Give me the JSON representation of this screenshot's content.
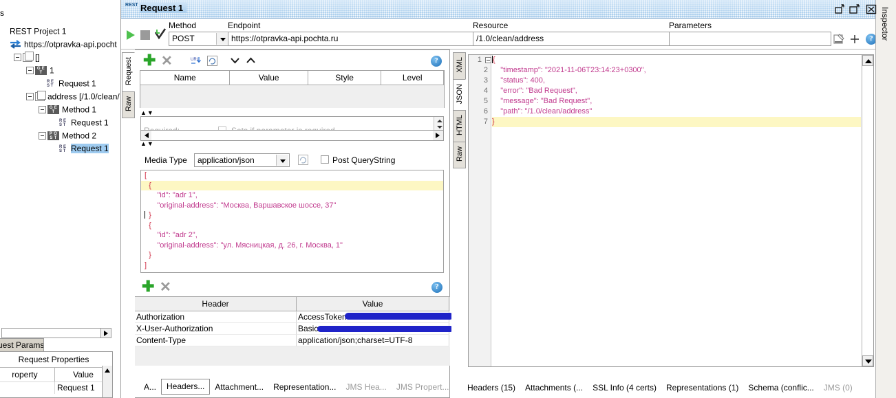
{
  "window": {
    "title": "Request 1",
    "title_icon": "rest-icon",
    "buttons": [
      {
        "name": "restore-button",
        "glyph": "restore"
      },
      {
        "name": "maximize-button",
        "glyph": "maximize"
      },
      {
        "name": "close-button",
        "glyph": "close"
      }
    ]
  },
  "navigator": {
    "header": "s",
    "hscroll": {
      "name": "navigator-hscrollbar"
    },
    "tree": [
      {
        "label": "REST Project 1",
        "icon": "project-icon",
        "indent": 0,
        "expander": false,
        "selected": false
      },
      {
        "label": "https://otpravka-api.pocht",
        "icon": "service-arrows-icon",
        "indent": 0,
        "expander": false,
        "selected": false
      },
      {
        "label": "[]",
        "icon": "resource-icon",
        "indent": 1,
        "expander": true,
        "selected": false
      },
      {
        "label": "1",
        "icon": "get-badge",
        "indent": 2,
        "expander": true,
        "selected": false
      },
      {
        "label": "Request 1",
        "icon": "rest-icon",
        "indent": 3,
        "expander": false,
        "selected": false
      },
      {
        "label": "address [/1.0/clean/",
        "icon": "resource-icon",
        "indent": 2,
        "expander": true,
        "selected": false
      },
      {
        "label": "Method 1",
        "icon": "get-badge",
        "indent": 3,
        "expander": true,
        "selected": false
      },
      {
        "label": "Request 1",
        "icon": "rest-icon",
        "indent": 4,
        "expander": false,
        "selected": false
      },
      {
        "label": "Method 2",
        "icon": "post-badge",
        "indent": 3,
        "expander": true,
        "selected": false
      },
      {
        "label": "Request 1",
        "icon": "rest-icon",
        "indent": 4,
        "expander": false,
        "selected": true
      }
    ],
    "request_params_tab": "uest Params",
    "properties": {
      "title": "Request Properties",
      "columns": [
        "roperty",
        "Value"
      ],
      "rows": [
        [
          "",
          "Request 1"
        ]
      ]
    }
  },
  "toolbar": {
    "run_button": "run-icon",
    "stop_button": "stop-icon",
    "validate_button": "check-icon",
    "method": {
      "label": "Method",
      "value": "POST"
    },
    "endpoint": {
      "label": "Endpoint",
      "value": "https://otpravka-api.pochta.ru"
    },
    "resource": {
      "label": "Resource",
      "value": "/1.0/clean/address"
    },
    "parameters": {
      "label": "Parameters",
      "value": ""
    },
    "param_editor_icon": "param-editor-icon",
    "add_param_icon": "plus-icon",
    "help_icon": "?"
  },
  "request_panel": {
    "vtabs": [
      {
        "label": "Request",
        "active": true
      },
      {
        "label": "Raw",
        "active": false
      }
    ],
    "param_toolbar": {
      "add": "plus-icon",
      "remove": "x-icon",
      "url_icon": "url-encode-icon",
      "refresh_icon": "refresh-icon",
      "down_icon": "move-down-icon",
      "up_icon": "move-up-icon",
      "help": "?"
    },
    "param_table": {
      "columns": [
        "Name",
        "Value",
        "Style",
        "Level"
      ],
      "rows": []
    },
    "param_detail": {
      "required_label": "Required:",
      "required_desc": "Sets if parameter is required",
      "checked": false
    },
    "media_type": {
      "label": "Media Type",
      "value": "application/json",
      "format_icon": "format-json-icon",
      "post_querystring": {
        "label": "Post QueryString",
        "checked": false
      }
    },
    "body_editor": {
      "lines": [
        {
          "text": "[",
          "cls": "jbrace",
          "hl": false
        },
        {
          "text": "  {",
          "cls": "jbrace",
          "hl": true
        },
        {
          "text": "      \"id\": \"adr 1\",",
          "cls": "jkey",
          "hl": false
        },
        {
          "text": "      \"original-address\": \"Москва, Варшавское шоссе, 37\"",
          "cls": "jkey",
          "hl": false
        },
        {
          "text": "  }",
          "cls": "jbrace",
          "hl": false
        },
        {
          "text": "  {",
          "cls": "jbrace",
          "hl": false
        },
        {
          "text": "      \"id\": \"adr 2\",",
          "cls": "jkey",
          "hl": false
        },
        {
          "text": "      \"original-address\": \"ул. Мясницкая, д. 26, г. Москва, 1\"",
          "cls": "jkey",
          "hl": false
        },
        {
          "text": "  }",
          "cls": "jbrace",
          "hl": false
        },
        {
          "text": "]",
          "cls": "jbrace",
          "hl": false
        }
      ]
    },
    "headers_toolbar": {
      "add": "plus-icon",
      "remove": "x-icon",
      "help": "?"
    },
    "headers_table": {
      "columns": [
        "Header",
        "Value"
      ],
      "rows": [
        {
          "header": "Authorization",
          "value": "AccessToken ",
          "redacted": true,
          "ellipsis": "..."
        },
        {
          "header": "X-User-Authorization",
          "value": "Basic ",
          "redacted": true,
          "ellipsis": "..."
        },
        {
          "header": "Content-Type",
          "value": "application/json;charset=UTF-8",
          "redacted": false,
          "ellipsis": ""
        }
      ]
    },
    "bottom_tabs": [
      {
        "label": "A...",
        "active": false,
        "dim": false
      },
      {
        "label": "Headers...",
        "active": true,
        "dim": false
      },
      {
        "label": "Attachment...",
        "active": false,
        "dim": false
      },
      {
        "label": "Representation...",
        "active": false,
        "dim": false
      },
      {
        "label": "JMS Hea...",
        "active": false,
        "dim": true
      },
      {
        "label": "JMS Propert...",
        "active": false,
        "dim": true
      }
    ]
  },
  "response_panel": {
    "vtabs": [
      {
        "label": "XML",
        "active": false
      },
      {
        "label": "JSON",
        "active": true
      },
      {
        "label": "HTML",
        "active": false
      },
      {
        "label": "Raw",
        "active": false
      }
    ],
    "editor": {
      "lines": [
        {
          "n": "1",
          "text": "{",
          "hl": false,
          "fold": true
        },
        {
          "n": "2",
          "text": "    \"timestamp\": \"2021-11-06T23:14:23+0300\",",
          "hl": false,
          "fold": false
        },
        {
          "n": "3",
          "text": "    \"status\": 400,",
          "hl": false,
          "fold": false
        },
        {
          "n": "4",
          "text": "    \"error\": \"Bad Request\",",
          "hl": false,
          "fold": false
        },
        {
          "n": "5",
          "text": "    \"message\": \"Bad Request\",",
          "hl": false,
          "fold": false
        },
        {
          "n": "6",
          "text": "    \"path\": \"/1.0/clean/address\"",
          "hl": false,
          "fold": false
        },
        {
          "n": "7",
          "text": "}",
          "hl": true,
          "fold": false
        }
      ]
    },
    "bottom_tabs": [
      {
        "label": "Headers (15)",
        "dim": false
      },
      {
        "label": "Attachments (...",
        "dim": false
      },
      {
        "label": "SSL Info (4 certs)",
        "dim": false
      },
      {
        "label": "Representations (1)",
        "dim": false
      },
      {
        "label": "Schema (conflic...",
        "dim": false
      },
      {
        "label": "JMS (0)",
        "dim": true
      }
    ]
  },
  "inspector": {
    "label": "Inspector"
  }
}
